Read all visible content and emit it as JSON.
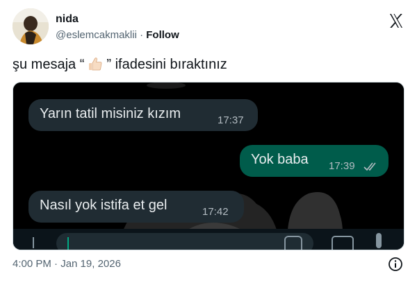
{
  "author": {
    "name": "nida",
    "handle": "@eslemcakmaklii",
    "separator": " · ",
    "follow_label": "Follow"
  },
  "tweet": {
    "text_before": "şu mesaja “",
    "emoji_icon": "thumbs-up-light-skin",
    "text_after": "” ifadesini bıraktınız"
  },
  "chat": {
    "messages": [
      {
        "direction": "incoming",
        "text": "Yarın tatil misiniz kızım",
        "time": "17:37"
      },
      {
        "direction": "outgoing",
        "text": "Yok baba",
        "time": "17:39",
        "status_icon": "double-check-icon"
      },
      {
        "direction": "incoming",
        "text": "Nasıl yok istifa et gel",
        "time": "17:42"
      }
    ],
    "colors": {
      "incoming": "#202c33",
      "outgoing": "#005c4b",
      "background": "#000000"
    }
  },
  "meta": {
    "timestamp": "4:00 PM · Jan 19, 2026"
  },
  "icons": {
    "brand": "x-logo-icon",
    "info": "info-icon"
  }
}
